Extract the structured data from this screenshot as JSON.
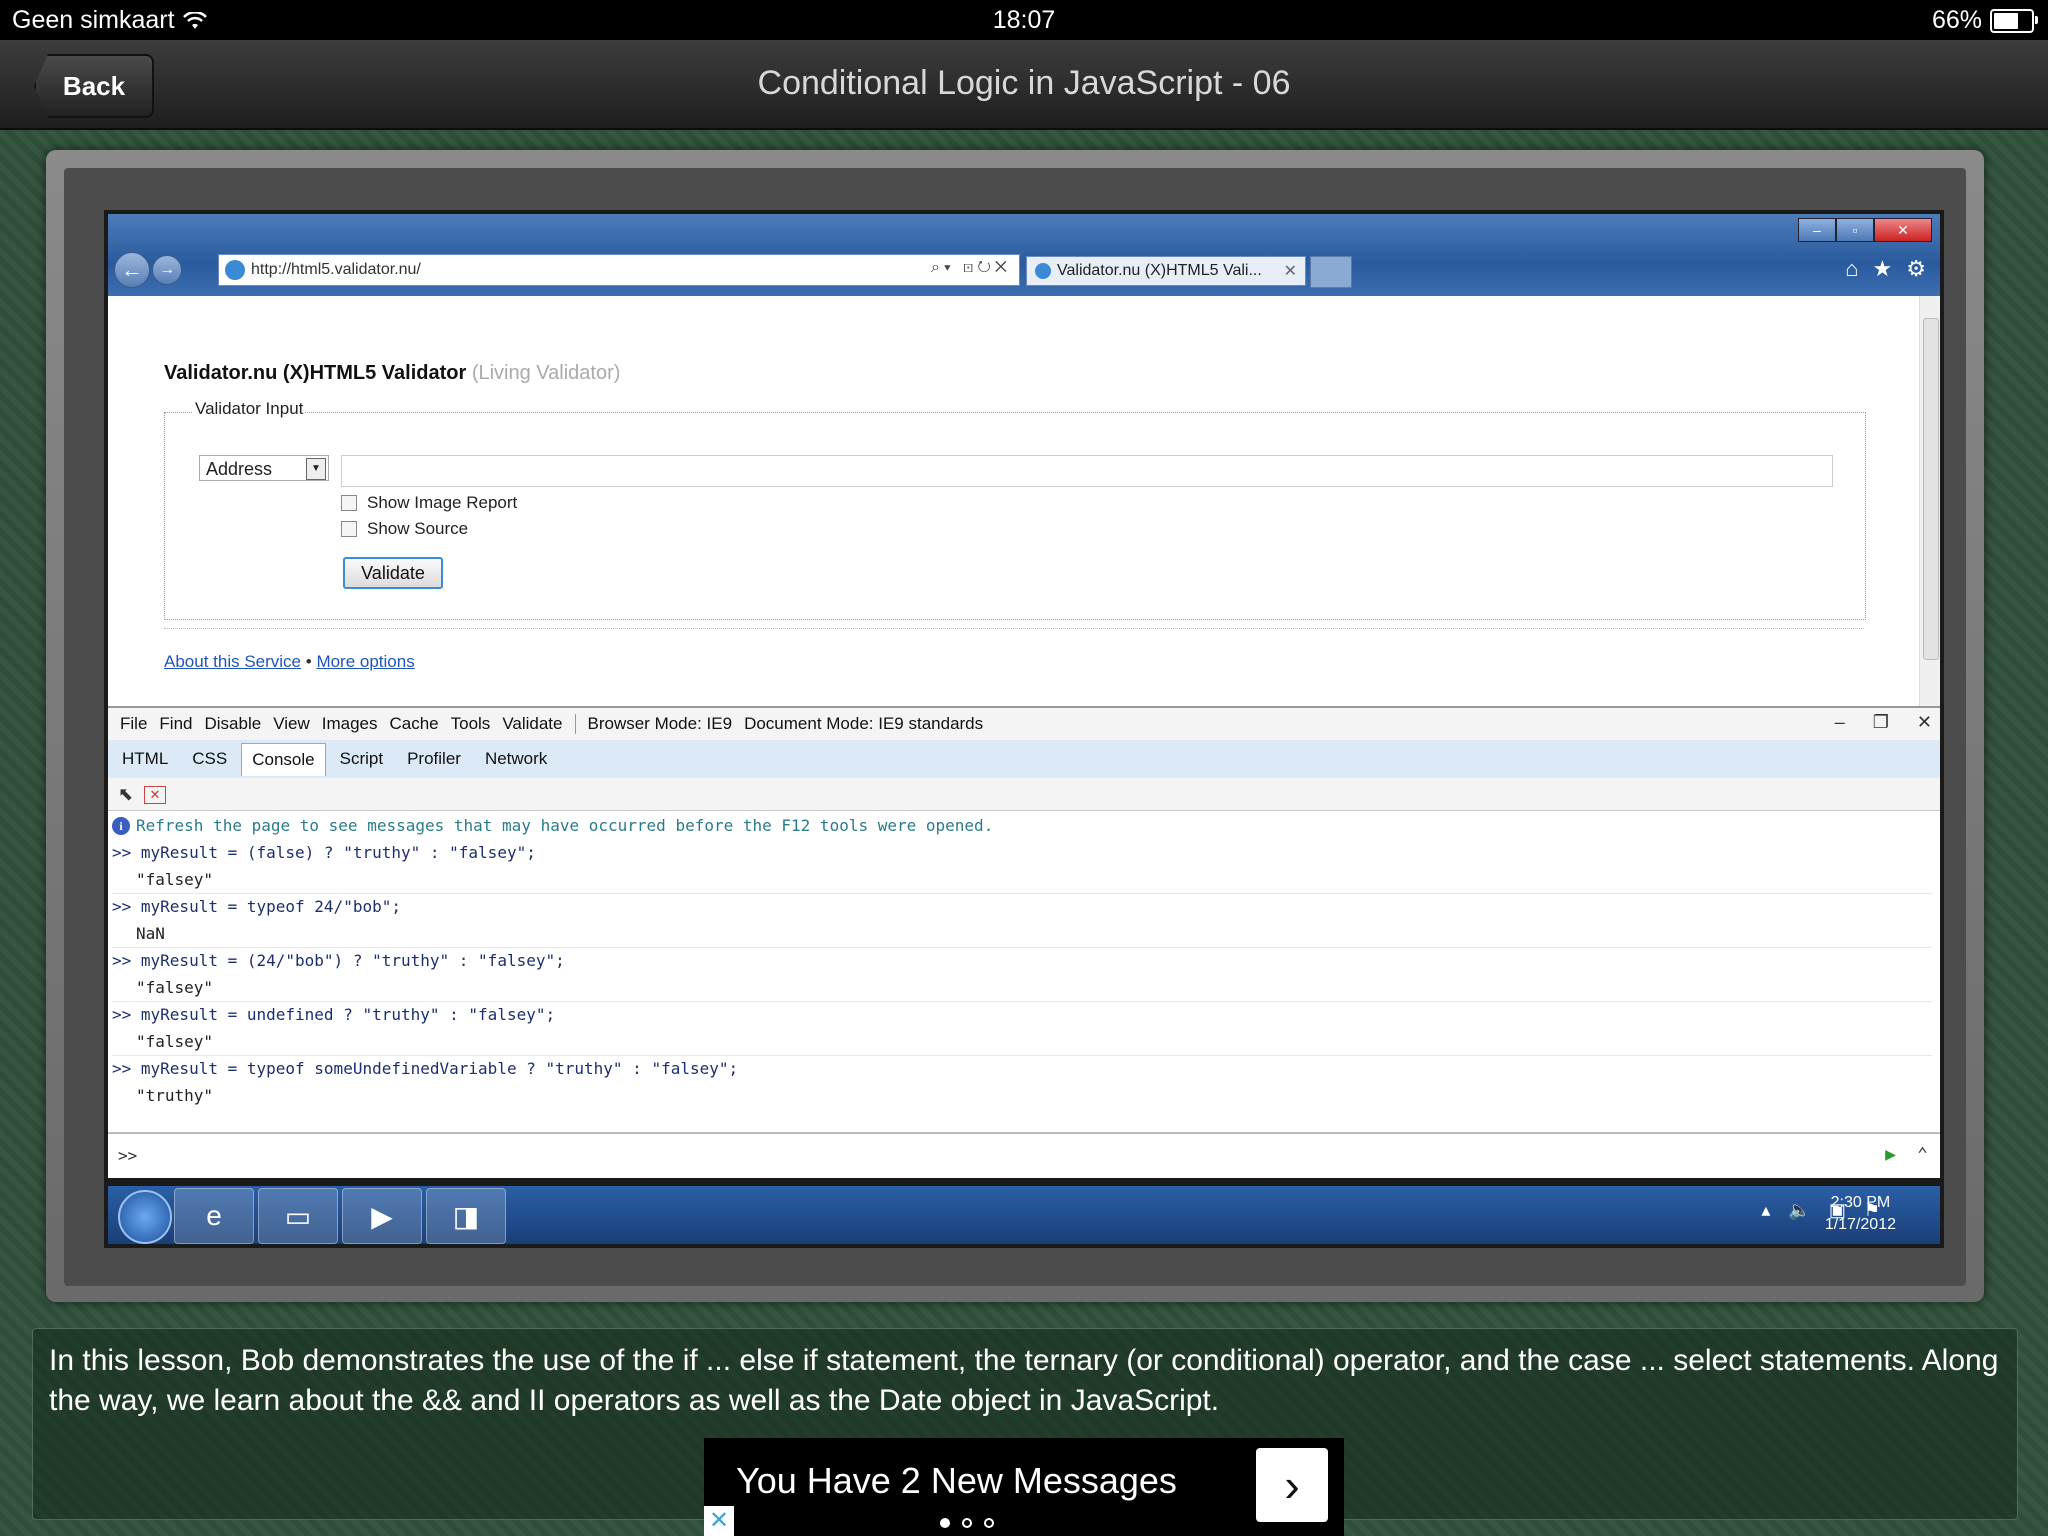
{
  "status_bar": {
    "carrier": "Geen simkaart",
    "time": "18:07",
    "battery": "66%"
  },
  "nav": {
    "back_label": "Back",
    "title": "Conditional Logic in JavaScript - 06"
  },
  "browser": {
    "url": "http://html5.validator.nu/",
    "tab_title": "Validator.nu (X)HTML5 Vali...",
    "page": {
      "title": "Validator.nu (X)HTML5 Validator",
      "title_suffix": "(Living Validator)",
      "legend": "Validator Input",
      "select_value": "Address",
      "checkbox_image_report": "Show Image Report",
      "checkbox_show_source": "Show Source",
      "validate_label": "Validate",
      "link_about": "About this Service",
      "link_separator": "•",
      "link_more": "More options"
    }
  },
  "devtools": {
    "menu": [
      "File",
      "Find",
      "Disable",
      "View",
      "Images",
      "Cache",
      "Tools",
      "Validate"
    ],
    "browser_mode": "Browser Mode: IE9",
    "document_mode": "Document Mode: IE9 standards",
    "tabs": [
      "HTML",
      "CSS",
      "Console",
      "Script",
      "Profiler",
      "Network"
    ],
    "active_tab": "Console",
    "info_message": "Refresh the page to see messages that may have occurred before the F12 tools were opened.",
    "entries": [
      {
        "cmd": ">> myResult = (false) ? \"truthy\" : \"falsey\";",
        "result": "\"falsey\""
      },
      {
        "cmd": ">> myResult = typeof 24/\"bob\";",
        "result": "NaN"
      },
      {
        "cmd": ">> myResult = (24/\"bob\") ? \"truthy\" : \"falsey\";",
        "result": "\"falsey\""
      },
      {
        "cmd": ">> myResult = undefined ? \"truthy\" : \"falsey\";",
        "result": "\"falsey\""
      },
      {
        "cmd": ">> myResult = typeof someUndefinedVariable ? \"truthy\" : \"falsey\";",
        "result": "\"truthy\""
      }
    ],
    "prompt": ">>"
  },
  "taskbar": {
    "clock_time": "2:30 PM",
    "clock_date": "1/17/2012"
  },
  "description": "In this lesson, Bob demonstrates the use of the if ... else if statement, the ternary (or conditional) operator, and the case ... select statements. Along the way, we learn about the && and II operators as well as the Date object in JavaScript.",
  "ad": {
    "text": "You Have 2 New Messages"
  },
  "icons": [
    "wifi-icon",
    "battery-icon",
    "back-arrow-icon",
    "forward-arrow-icon",
    "ie-icon",
    "home-icon",
    "star-icon",
    "gear-icon",
    "info-icon",
    "select-element-icon",
    "clear-console-icon",
    "run-icon",
    "expand-icon",
    "windows-start-icon",
    "explorer-icon",
    "media-player-icon",
    "chevron-right-icon",
    "close-icon"
  ],
  "colors": {
    "background_green": "#2d4a36",
    "ie_blue": "#2a5b9e",
    "console_text": "#1c2f6e",
    "link_blue": "#2255bb"
  }
}
